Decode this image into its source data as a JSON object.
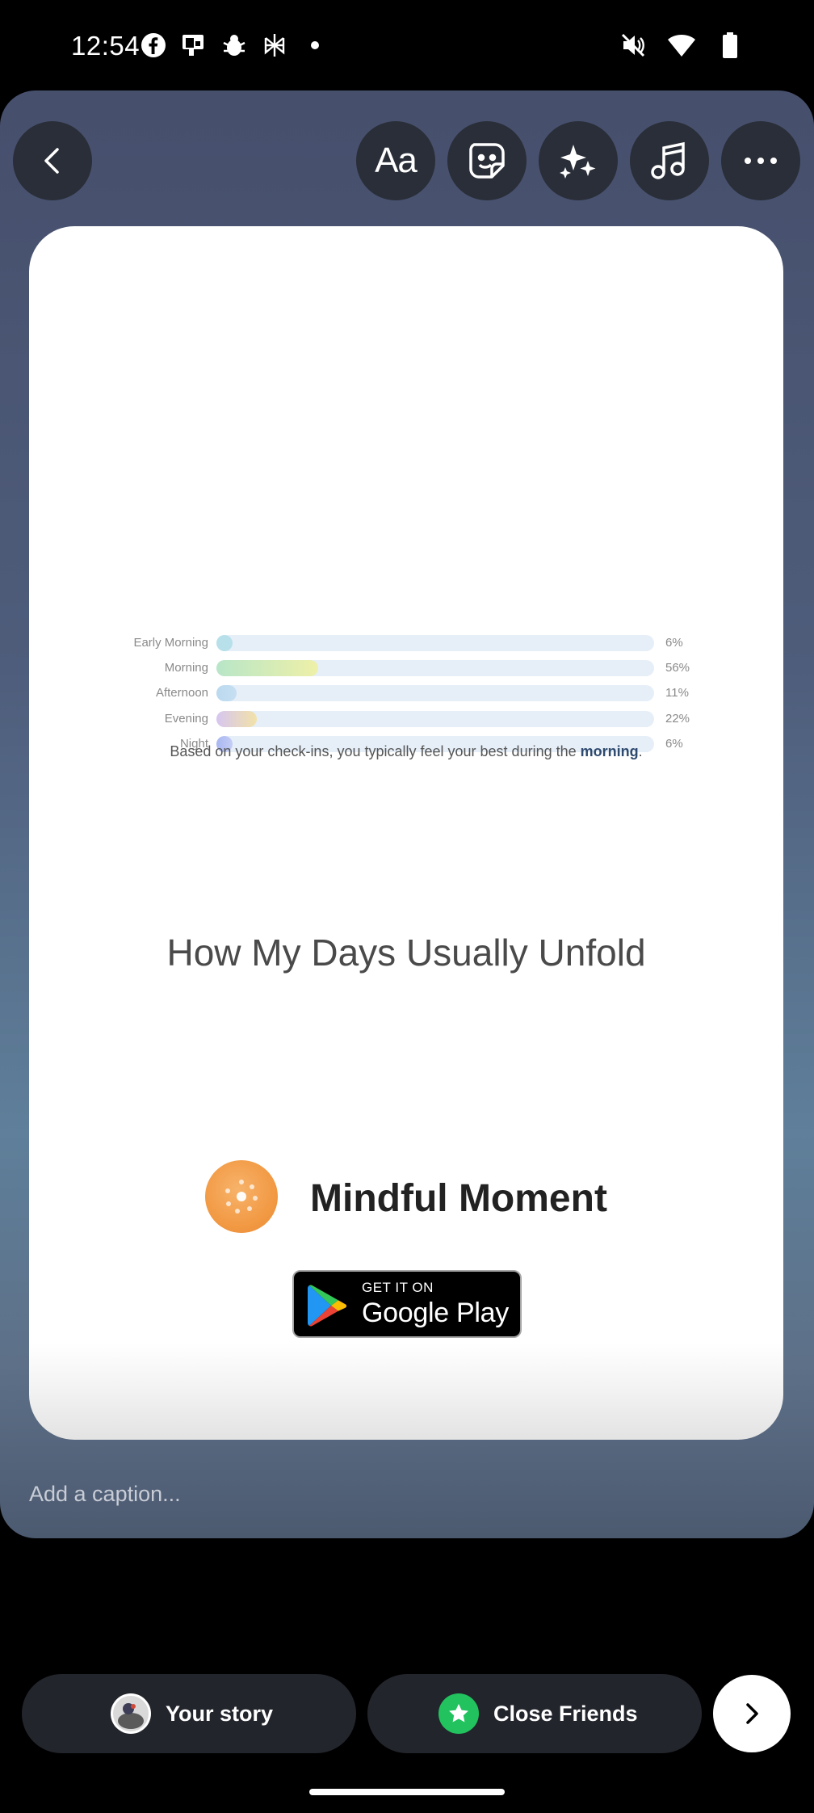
{
  "status_bar": {
    "time": "12:54",
    "left_icons": [
      "facebook-icon",
      "screencast-icon",
      "bug-icon",
      "perplexity-icon",
      "notification-dot-icon"
    ],
    "right_icons": [
      "mute-icon",
      "wifi-icon",
      "battery-icon"
    ]
  },
  "toolbar": {
    "back": "chevron-left-icon",
    "tools": [
      "text-icon",
      "sticker-icon",
      "effects-icon",
      "music-icon",
      "more-icon"
    ],
    "text_label": "Aa"
  },
  "story": {
    "chart_data": {
      "type": "bar",
      "orientation": "horizontal",
      "categories": [
        "Early Morning",
        "Morning",
        "Afternoon",
        "Evening",
        "Night"
      ],
      "values": [
        6,
        56,
        11,
        22,
        6
      ],
      "value_labels": [
        "6%",
        "56%",
        "11%",
        "22%",
        "6%"
      ],
      "xlim": [
        0,
        240
      ],
      "colors": [
        [
          "#b8e0ea",
          "#b8e0ea"
        ],
        [
          "#b8e6c8",
          "#eef0a8"
        ],
        [
          "#bad9ef",
          "#c7dff1"
        ],
        [
          "#d6c6f0",
          "#f2e2a8"
        ],
        [
          "#a9b7f2",
          "#c4cdf5"
        ]
      ],
      "grid": false
    },
    "insight_prefix": "Based on your check-ins, you typically feel your best during the ",
    "insight_highlight": "morning",
    "insight_suffix": ".",
    "title": "How My Days Usually Unfold",
    "app_name": "Mindful Moment",
    "store_badge": {
      "top": "GET IT ON",
      "main": "Google Play"
    }
  },
  "caption": {
    "placeholder": "Add a caption..."
  },
  "bottom_bar": {
    "your_story": "Your story",
    "close_friends": "Close Friends",
    "colors": {
      "close_friends_badge": "#22c35e"
    }
  }
}
